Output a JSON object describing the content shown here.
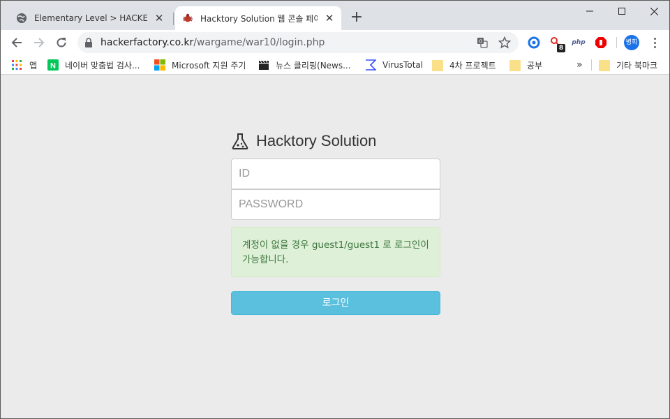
{
  "browser": {
    "tabs": [
      {
        "title": "Elementary Level > HACKER FA",
        "active": false
      },
      {
        "title": "Hacktory Solution 웹 콘솔 페이",
        "active": true
      }
    ],
    "url_host": "hackerfactory.co.kr",
    "url_path": "/wargame/war10/login.php",
    "profile_label": "병희",
    "extension_badge": "8",
    "php_label": "php"
  },
  "bookmarks": [
    {
      "label": "앱",
      "icon": "apps-grid-icon"
    },
    {
      "label": "네이버 맞춤법 검사...",
      "icon": "naver-icon"
    },
    {
      "label": "Microsoft 지원 주기",
      "icon": "microsoft-icon"
    },
    {
      "label": "뉴스 클리핑(News...",
      "icon": "clapper-icon"
    },
    {
      "label": "VirusTotal",
      "icon": "virustotal-icon"
    },
    {
      "label": "4차 프로젝트",
      "icon": "folder-icon"
    },
    {
      "label": "공부",
      "icon": "folder-icon"
    },
    {
      "label": "기타 북마크",
      "icon": "folder-icon"
    }
  ],
  "bookmarks_overflow": "»",
  "login": {
    "brand_name": "Hacktory Solution",
    "id_placeholder": "ID",
    "password_placeholder": "PASSWORD",
    "notice": "계정이 없을 경우 guest1/guest1 로 로그인이 가능합니다.",
    "submit_label": "로그인"
  },
  "colors": {
    "button": "#5bc0de",
    "notice_bg": "#dff0d8",
    "notice_text": "#3c763d",
    "page_bg": "#ebebeb"
  }
}
